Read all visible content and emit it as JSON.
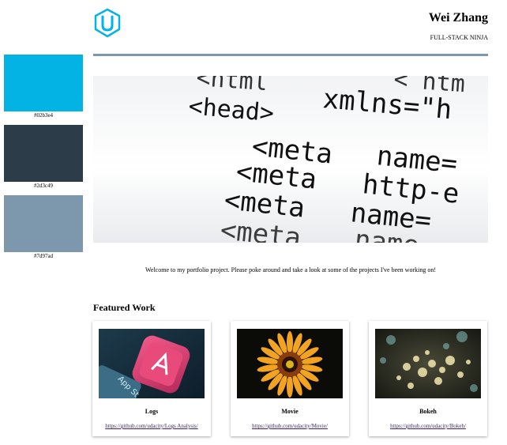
{
  "swatches": [
    {
      "color": "#02b3e4",
      "label": "#02b3e4"
    },
    {
      "color": "#2d3c49",
      "label": "#2d3c49"
    },
    {
      "color": "#7d97ad",
      "label": "#7d97ad"
    }
  ],
  "header": {
    "logo_icon": "udacity-logo-icon",
    "name": "Wei Zhang",
    "tagline": "FULL-STACK NINJA"
  },
  "hero": {
    "lines": [
      "<html    <html",
      "<head>  xmlns=\"h",
      "<meta name=",
      "<meta http-e",
      "<meta name=",
      "<meta name="
    ]
  },
  "welcome": "Welcome to my portfolio project. Please poke around and take a look at some of the projects I've been working on!",
  "featured": {
    "title": "Featured Work",
    "items": [
      {
        "title": "Logs",
        "link": "https://github.com/udacity/Logs Analysis/"
      },
      {
        "title": "Movie",
        "link": "https://github.com/udacity/Movie/"
      },
      {
        "title": "Bokeh",
        "link": "https://github.com/udacity/Bokeh/"
      }
    ]
  }
}
